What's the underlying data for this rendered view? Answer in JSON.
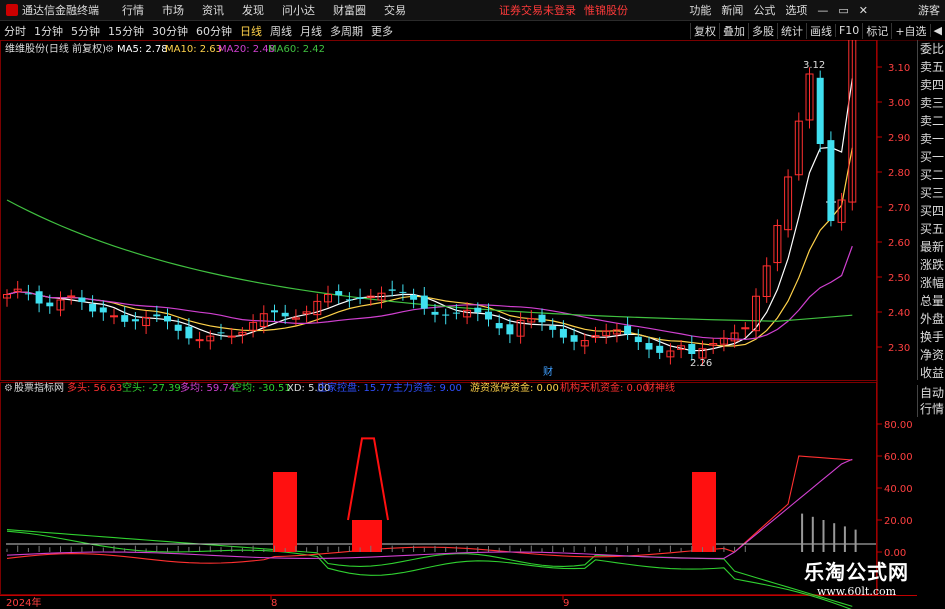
{
  "menubar": {
    "brand": "通达信金融终端",
    "menus": [
      "行情",
      "市场",
      "资讯",
      "发现",
      "问小达",
      "财富圈",
      "交易"
    ],
    "notice": "证券交易未登录",
    "stock_name": "惟锦股份",
    "right": [
      "功能",
      "新闻",
      "公式",
      "选项"
    ],
    "user": "游客"
  },
  "periodbar": {
    "periods": [
      "分时",
      "1分钟",
      "5分钟",
      "15分钟",
      "30分钟",
      "60分钟",
      "日线",
      "周线",
      "月线",
      "多周期",
      "更多"
    ],
    "active": "日线",
    "tools": [
      "复权",
      "叠加",
      "多股",
      "统计",
      "画线",
      "F10",
      "标记",
      "+自选",
      "◀"
    ]
  },
  "price_panel": {
    "title": "维维股份(日线 前复权)",
    "ma_labels": [
      {
        "text": "MA5: 2.78",
        "color": "#ffffff"
      },
      {
        "text": "MA10: 2.63",
        "color": "#ffd24a"
      },
      {
        "text": "MA20: 2.48",
        "color": "#d040d0"
      },
      {
        "text": "MA60: 2.42",
        "color": "#40c040"
      }
    ],
    "y_ticks": [
      "3.10",
      "3.00",
      "2.90",
      "2.80",
      "2.70",
      "2.60",
      "2.50",
      "2.40",
      "2.30"
    ],
    "high_label": "3.12",
    "low_label": "2.26",
    "event_marker": "财",
    "current_price_marker": "2.72"
  },
  "indicator_panel": {
    "title": "股票指标网",
    "labels": [
      {
        "text": "多头: 56.63",
        "color": "#ff3030"
      },
      {
        "text": "空头: -27.39",
        "color": "#30d030"
      },
      {
        "text": "多均: 59.74",
        "color": "#d040d0"
      },
      {
        "text": "空均: -30.51",
        "color": "#30d030"
      },
      {
        "text": "XD: 5.00",
        "color": "#dddddd"
      },
      {
        "text": "庄家控盘: 15.77",
        "color": "#3050ff"
      },
      {
        "text": "主力资金: 9.00",
        "color": "#3050ff"
      },
      {
        "text": "游资涨停资金: 0.00",
        "color": "#ffd24a"
      },
      {
        "text": "机构天机资金: 0.00",
        "color": "#ff3030"
      },
      {
        "text": "财神线",
        "color": "#ff3030"
      }
    ],
    "y_ticks": [
      "80.00",
      "60.00",
      "40.00",
      "20.00",
      "0.00"
    ]
  },
  "x_axis": {
    "labels": [
      "2024年",
      "8",
      "9"
    ]
  },
  "sidepanel": {
    "items": [
      "委比",
      "卖五",
      "卖四",
      "卖三",
      "卖二",
      "卖一",
      "买一",
      "买二",
      "买三",
      "买四",
      "买五",
      "最新",
      "涨跌",
      "涨幅",
      "总量",
      "外盘",
      "换手",
      "净资",
      "收益"
    ]
  },
  "sidepanel2": {
    "items": [
      "自动",
      "行情"
    ]
  },
  "watermark": {
    "line1": "乐淘公式网",
    "line2": "www.60lt.com"
  },
  "colors": {
    "up": "#ff3030",
    "down": "#40e0f0",
    "ma5": "#ffffff",
    "ma10": "#ffd24a",
    "ma20": "#d040d0",
    "ma60": "#40c040",
    "axis": "#ff2020"
  }
}
